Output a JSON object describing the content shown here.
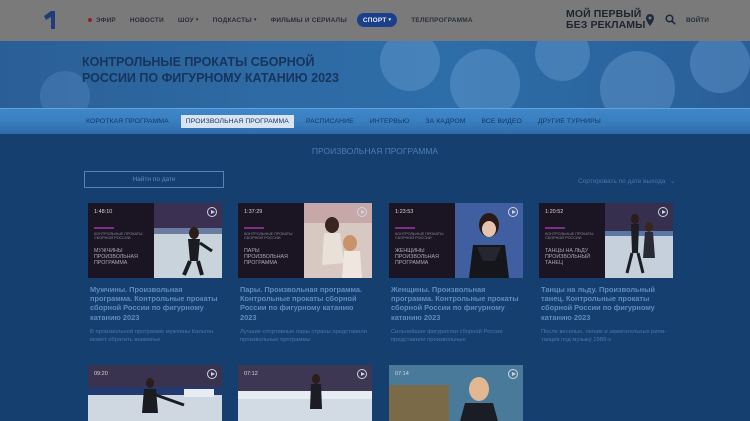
{
  "header": {
    "nav": [
      {
        "label": "Эфир",
        "live": true
      },
      {
        "label": "Новости"
      },
      {
        "label": "Шоу",
        "dropdown": true
      },
      {
        "label": "Подкасты",
        "dropdown": true
      },
      {
        "label": "Фильмы и сериалы"
      },
      {
        "label": "Спорт",
        "dropdown": true,
        "active": true
      },
      {
        "label": "Телепрограмма"
      }
    ],
    "promo_line1": "МОЙ ПЕРВЫЙ",
    "promo_line2": "БЕЗ РЕКЛАМЫ",
    "login": "ВОЙТИ"
  },
  "banner": {
    "title": "Контрольные прокаты сборной России по фигурному катанию 2023"
  },
  "subnav": [
    {
      "label": "Короткая программа"
    },
    {
      "label": "Произвольная программа",
      "active": true
    },
    {
      "label": "Расписание"
    },
    {
      "label": "Интервью"
    },
    {
      "label": "За кадром"
    },
    {
      "label": "Все видео"
    },
    {
      "label": "Другие турниры"
    }
  ],
  "main": {
    "section_title": "Произвольная программа",
    "search_label": "Найти по дате",
    "sort_label": "Сортировать по дате выхода"
  },
  "cards": [
    {
      "duration": "1:48:10",
      "panel_text": "Контрольные прокаты сборной России",
      "panel_name": "Мужчины произвольная программа",
      "title": "Мужчины. Произвольная программа. Контрольные прокаты сборной России по фигурному катанию 2023",
      "desc": "В произвольной программе мужчины Кальтон может обратить вниманье"
    },
    {
      "duration": "1:37:29",
      "panel_text": "Контрольные прокаты сборной России",
      "panel_name": "Пары произвольная программа",
      "title": "Пары. Произвольная программа. Контрольные прокаты сборной России по фигурному катанию 2023",
      "desc": "Лучшие спортивные пары страны представили произвольные программы"
    },
    {
      "duration": "1:23:53",
      "panel_text": "Контрольные прокаты сборной России",
      "panel_name": "Женщины произвольная программа",
      "title": "Женщины. Произвольная программа. Контрольные прокаты сборной России по фигурному катанию 2023",
      "desc": "Сильнейшие фигуристки сборной России представили произвольные"
    },
    {
      "duration": "1:20:52",
      "panel_text": "Контрольные прокаты сборной России",
      "panel_name": "Танцы на льду произвольный танец",
      "title": "Танцы на льду. Произвольный танец. Контрольные прокаты сборной России по фигурному катанию 2023",
      "desc": "После веселых, легких и зажигательных ритм-танцев под музыку 1980-х"
    }
  ],
  "cards_row2": [
    {
      "duration": "09:20"
    },
    {
      "duration": "07:12"
    },
    {
      "duration": "07:14"
    }
  ]
}
